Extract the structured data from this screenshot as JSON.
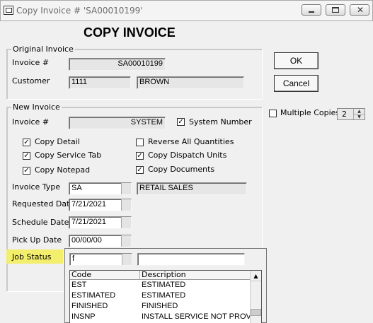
{
  "window": {
    "title": "Copy Invoice # 'SA00010199'"
  },
  "heading": "COPY INVOICE",
  "original": {
    "group_label": "Original Invoice",
    "invoice_label": "Invoice #",
    "invoice_value": "SA00010199",
    "customer_label": "Customer",
    "customer_id": "1111",
    "customer_name": "BROWN"
  },
  "buttons": {
    "ok": "OK",
    "cancel": "Cancel"
  },
  "multiple_copies": {
    "label": "Multiple Copies",
    "value": "2",
    "checked": false
  },
  "new_invoice": {
    "group_label": "New Invoice",
    "invoice_label": "Invoice #",
    "invoice_value": "SYSTEM",
    "system_number_label": "System Number",
    "system_number_checked": true,
    "options": {
      "copy_detail": "Copy Detail",
      "copy_service_tab": "Copy Service Tab",
      "copy_notepad": "Copy Notepad",
      "reverse_all_quantities": "Reverse All Quantities",
      "copy_dispatch_units": "Copy Dispatch Units",
      "copy_documents": "Copy Documents"
    },
    "invoice_type_label": "Invoice Type",
    "invoice_type_code": "SA",
    "invoice_type_desc": "RETAIL SALES",
    "requested_date_label": "Requested Date",
    "requested_date": "7/21/2021",
    "schedule_date_label": "Schedule Date",
    "schedule_date": "7/21/2021",
    "pickup_date_label": "Pick Up Date",
    "pickup_date": "00/00/00",
    "job_status_label": "Job Status"
  },
  "lookup": {
    "input_value": "f",
    "desc_value": "",
    "columns": [
      "Code",
      "Description"
    ],
    "rows": [
      {
        "code": "EST",
        "desc": "ESTIMATED"
      },
      {
        "code": "ESTIMATED",
        "desc": "ESTIMATED"
      },
      {
        "code": "FINISHED",
        "desc": "FINISHED"
      },
      {
        "code": "INSNP",
        "desc": "INSTALL SERVICE NOT PROV"
      }
    ]
  },
  "colors": {
    "highlight": "#f3ef6c",
    "readonly_bg": "#e6e6e6"
  }
}
